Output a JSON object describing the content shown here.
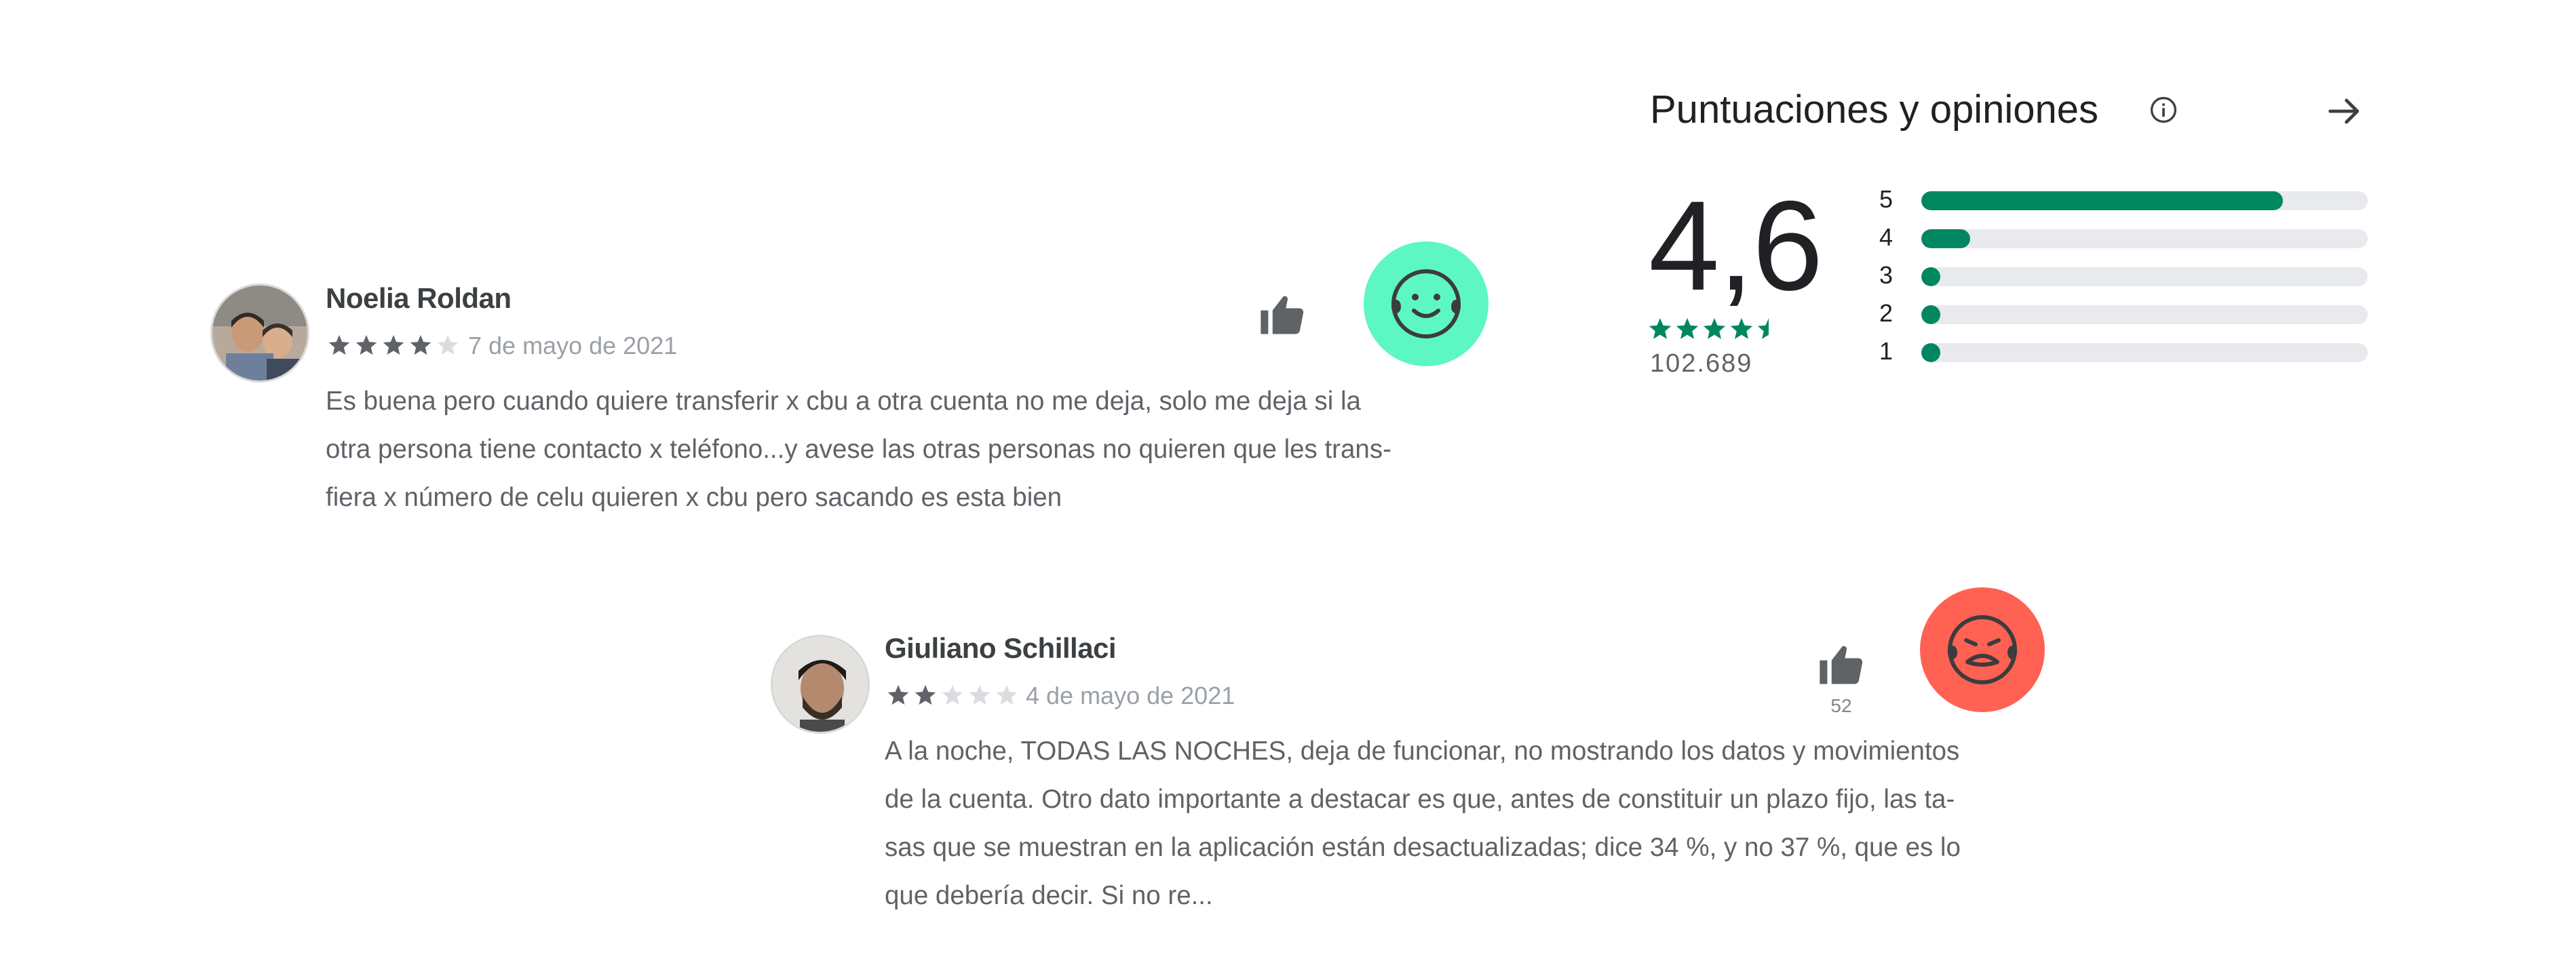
{
  "ratings": {
    "title": "Puntuaciones y opiniones",
    "info_icon": "info-icon",
    "arrow_icon": "arrow-right-icon",
    "score": "4,6",
    "score_stars": 4.5,
    "count": "102.689",
    "histogram": [
      {
        "label": "5",
        "fraction": 0.81
      },
      {
        "label": "4",
        "fraction": 0.11
      },
      {
        "label": "3",
        "fraction": 0.02
      },
      {
        "label": "2",
        "fraction": 0.02
      },
      {
        "label": "1",
        "fraction": 0.02
      }
    ],
    "bar_color": "#01875f",
    "track_color": "#e8eaed"
  },
  "reviews": [
    {
      "name": "Noelia Roldan",
      "stars": 4,
      "date": "7 de mayo de 2021",
      "text_lines": [
        "Es buena pero cuando quiere transferir x cbu a otra cuenta no me deja, solo me deja si la",
        "otra persona tiene contacto x teléfono...y avese las otras personas no quieren que les trans-",
        "fiera x número de celu quieren x cbu pero sacando es esta bien"
      ],
      "helpful_count": "",
      "sentiment": "happy-face-icon",
      "sentiment_color": "#5cf7c3"
    },
    {
      "name": "Giuliano Schillaci",
      "stars": 2,
      "date": "4 de mayo de 2021",
      "text_lines": [
        "A la noche, TODAS LAS NOCHES, deja de funcionar, no mostrando los datos y movimientos",
        "de la cuenta. Otro dato importante a destacar es que, antes de constituir un plazo fijo, las ta-",
        "sas que se muestran en la aplicación están desactualizadas; dice 34 %, y no 37 %, que es lo",
        "que debería decir. Si no re..."
      ],
      "helpful_count": "52",
      "sentiment": "sad-face-icon",
      "sentiment_color": "#ff6153"
    }
  ],
  "star_color_active": "#5f6368",
  "star_color_inactive": "#dadce0",
  "brand_green": "#01875f"
}
